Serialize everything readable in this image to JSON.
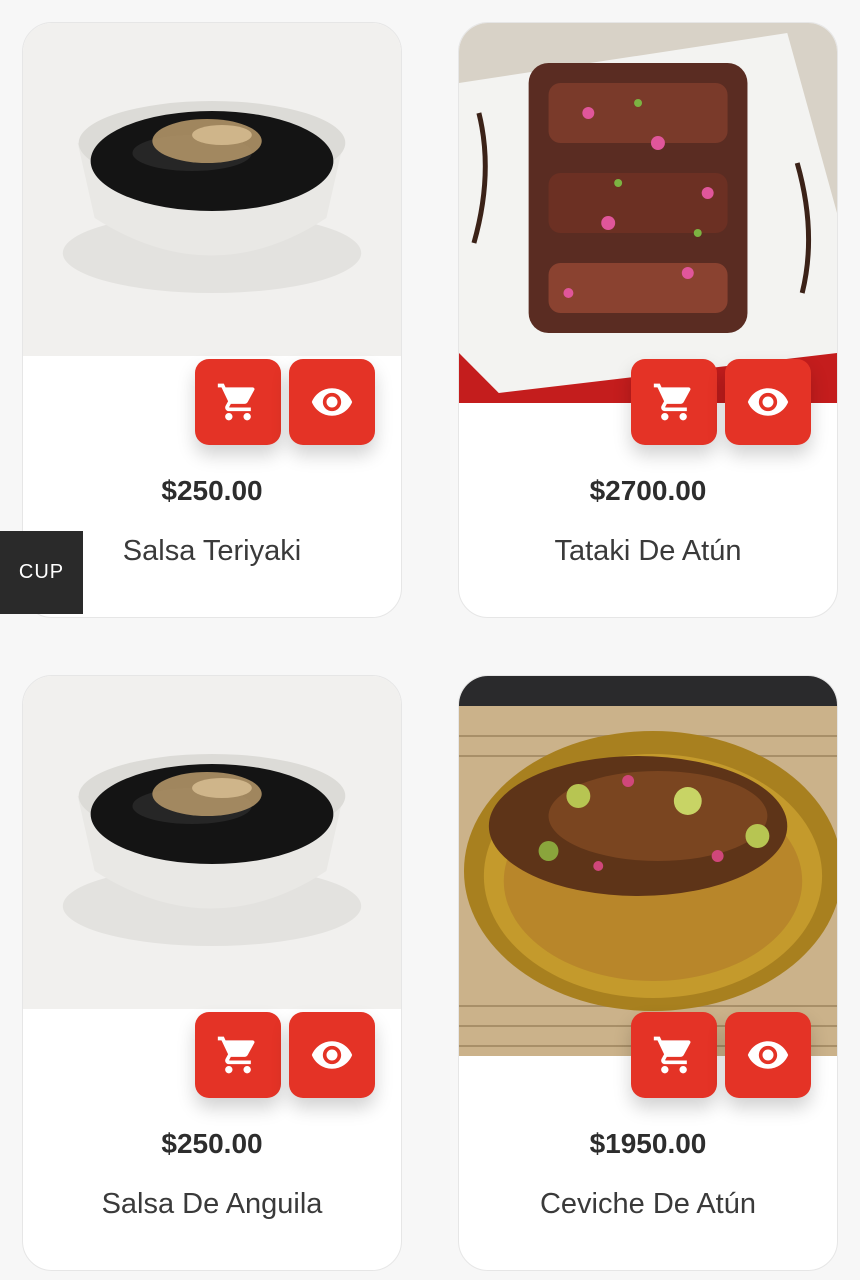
{
  "products": [
    {
      "price": "$250.00",
      "name": "Salsa Teriyaki",
      "image": "teriyaki-sauce-bowl"
    },
    {
      "price": "$2700.00",
      "name": "Tataki De Atún",
      "image": "tuna-tataki-plate"
    },
    {
      "price": "$250.00",
      "name": "Salsa De Anguila",
      "image": "eel-sauce-bowl"
    },
    {
      "price": "$1950.00",
      "name": "Ceviche De Atún",
      "image": "tuna-ceviche-plate"
    }
  ],
  "currency_toggle": {
    "label": "CUP"
  },
  "icons": {
    "cart": "cart-icon",
    "view": "eye-icon"
  },
  "colors": {
    "accent": "#e43326",
    "currency_bg": "#2a2a2a"
  }
}
